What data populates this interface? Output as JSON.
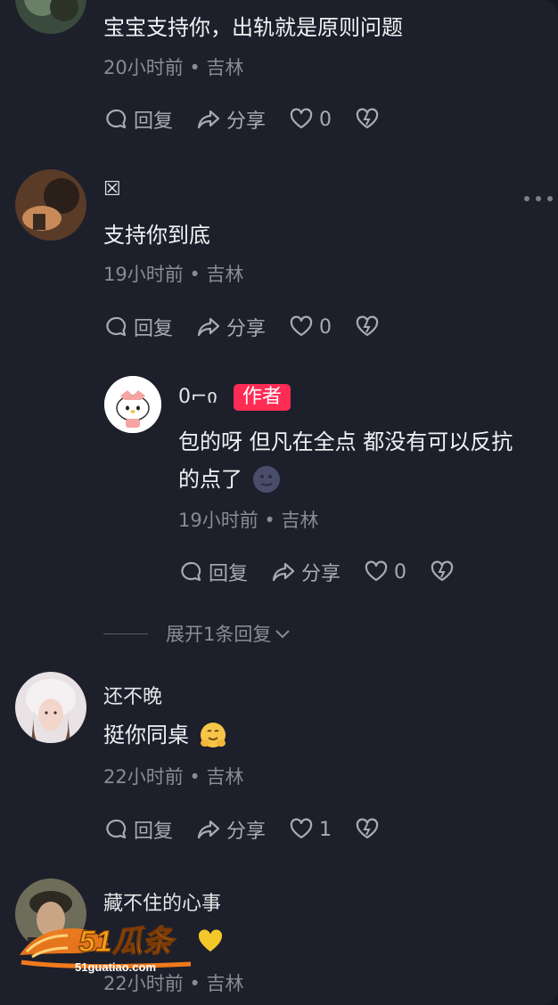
{
  "comments": [
    {
      "text": "宝宝支持你，出轨就是原则问题",
      "meta": "20小时前 • 吉林",
      "actions": {
        "reply": "回复",
        "share": "分享",
        "likes": "0"
      }
    },
    {
      "username": "☒",
      "text": "支持你到底",
      "meta": "19小时前 • 吉林",
      "actions": {
        "reply": "回复",
        "share": "分享",
        "likes": "0"
      }
    },
    {
      "username": "0⌐ი",
      "badge": "作者",
      "text_line1": "包的呀 但凡在全点 都没有可以反抗",
      "text_line2": "的点了",
      "meta": "19小时前 • 吉林",
      "actions": {
        "reply": "回复",
        "share": "分享",
        "likes": "0"
      }
    },
    {
      "username": "还不晚",
      "text": "挺你同桌",
      "meta": "22小时前 • 吉林",
      "actions": {
        "reply": "回复",
        "share": "分享",
        "likes": "1"
      }
    },
    {
      "username": "藏不住的心事",
      "meta": "22小时前 • 吉林"
    }
  ],
  "expand_replies": "展开1条回复",
  "watermark": {
    "brand": "51瓜条",
    "site": "51guatiao.com"
  },
  "colors": {
    "background": "#1d1f2b",
    "author_badge": "#fe2c55",
    "meta": "#8a8b93"
  },
  "icons": [
    "comment-icon",
    "share-icon",
    "heart-icon",
    "broken-heart-icon",
    "more-icon",
    "chevron-down-icon"
  ]
}
